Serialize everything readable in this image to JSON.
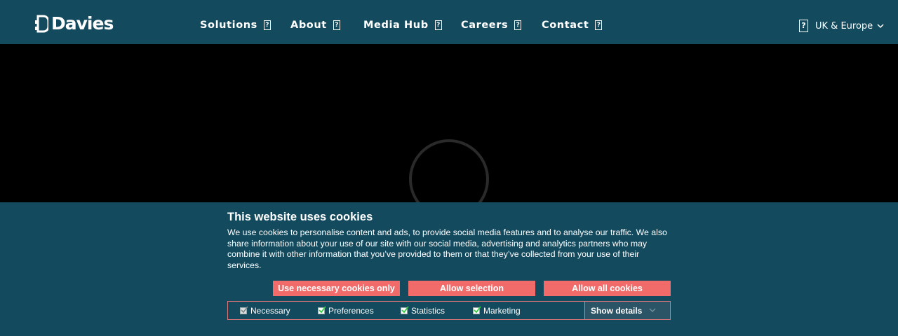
{
  "header": {
    "logo_text": "Davies",
    "nav": [
      {
        "label": "Solutions"
      },
      {
        "label": "About"
      },
      {
        "label": "Media Hub"
      },
      {
        "label": "Careers"
      },
      {
        "label": "Contact"
      }
    ],
    "region": {
      "label": "UK & Europe",
      "icon": "globe-icon"
    },
    "missing_glyph": "?"
  },
  "cookie_banner": {
    "title": "This website uses cookies",
    "text": "We use cookies to personalise content and ads, to provide social media features and to analyse our traffic. We also share information about your use of our site with our social media, advertising and analytics partners who may combine it with other information that you’ve provided to them or that they’ve collected from your use of their services.",
    "buttons": {
      "necessary_only": "Use necessary cookies only",
      "allow_selection": "Allow selection",
      "allow_all": "Allow all cookies"
    },
    "checkboxes": [
      {
        "label": "Necessary",
        "checked": true,
        "disabled": true
      },
      {
        "label": "Preferences",
        "checked": true
      },
      {
        "label": "Statistics",
        "checked": true
      },
      {
        "label": "Marketing",
        "checked": true
      }
    ],
    "show_details": "Show details"
  },
  "colors": {
    "header_bg": "#134a5e",
    "button_bg": "#f26b6b",
    "check_green": "#2ecc40"
  }
}
